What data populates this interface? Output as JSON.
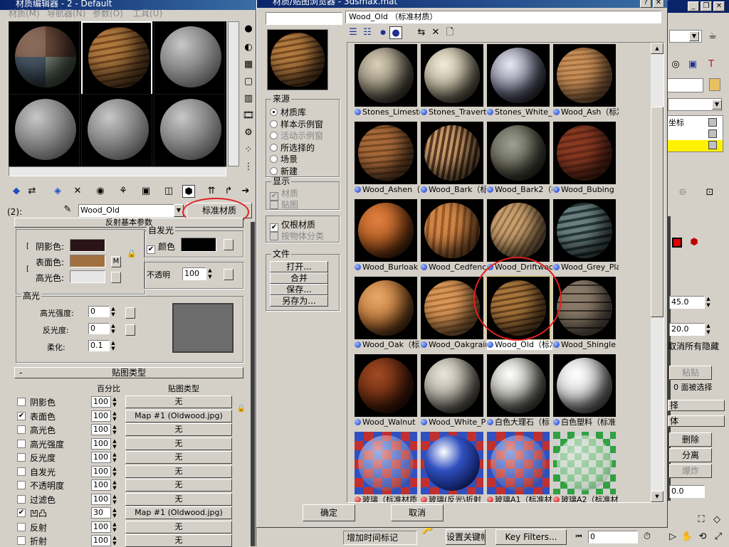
{
  "left_window": {
    "title": "材质编辑器 - 2 - Default",
    "menu": [
      "材质(M)",
      "导航器(N)",
      "参数(O)",
      "工具(U)"
    ],
    "slot_label": "(2):",
    "material_name": "Wood_Old",
    "material_type_button": "标准材质",
    "rollout_title": "反射基本参数",
    "ambient_label": "阴影色:",
    "diffuse_label": "表面色:",
    "specular_label": "高光色:",
    "m_button": "M",
    "self_illum_title": "自发光",
    "color_label": "颜色",
    "opacity_label": "不透明",
    "opacity_value": "100",
    "specular_group": "高光",
    "spec_level_label": "高光强度:",
    "spec_level_value": "0",
    "glossiness_label": "反光度:",
    "glossiness_value": "0",
    "soften_label": "柔化:",
    "soften_value": "0.1",
    "maps_rollout_title": "贴图类型",
    "maps_minus": "-",
    "maps_col_amount": "百分比",
    "maps_col_type": "贴图类型",
    "maps": [
      {
        "name": "阴影色",
        "checked": false,
        "amount": "100",
        "map": "无"
      },
      {
        "name": "表面色",
        "checked": true,
        "amount": "100",
        "map": "Map #1 (Oldwood.jpg)"
      },
      {
        "name": "高光色",
        "checked": false,
        "amount": "100",
        "map": "无"
      },
      {
        "name": "高光强度",
        "checked": false,
        "amount": "100",
        "map": "无"
      },
      {
        "name": "反光度",
        "checked": false,
        "amount": "100",
        "map": "无"
      },
      {
        "name": "自发光",
        "checked": false,
        "amount": "100",
        "map": "无"
      },
      {
        "name": "不透明度",
        "checked": false,
        "amount": "100",
        "map": "无"
      },
      {
        "name": "过滤色",
        "checked": false,
        "amount": "100",
        "map": "无"
      },
      {
        "name": "凹凸",
        "checked": true,
        "amount": "30",
        "map": "Map #1 (Oldwood.jpg)"
      },
      {
        "name": "反射",
        "checked": false,
        "amount": "100",
        "map": "无"
      },
      {
        "name": "折射",
        "checked": false,
        "amount": "100",
        "map": "无"
      }
    ]
  },
  "browser": {
    "title": "材质/贴图浏览器 - 3dsmax.mat",
    "selected_display": "Wood_Old （标准材质）",
    "source_group": "来源",
    "source_options": [
      "材质库",
      "样本示例窗",
      "活动示例窗",
      "所选择的",
      "场景",
      "新建"
    ],
    "display_group": "显示",
    "display_options": [
      "材质",
      "贴图"
    ],
    "root_only": "仅根材质",
    "by_object": "按物体分类",
    "file_group": "文件",
    "file_buttons": [
      "打开...",
      "合并",
      "保存...",
      "另存为..."
    ],
    "ok": "确定",
    "cancel": "取消",
    "items": [
      {
        "label": "Stones_Limesto",
        "style": "limestone"
      },
      {
        "label": "Stones_Travertin",
        "style": "travertine"
      },
      {
        "label": "Stones_White_C",
        "style": "whitestone"
      },
      {
        "label": "Wood_Ash（标准",
        "style": "ash"
      },
      {
        "label": "Wood_Ashen（标",
        "style": "ashen"
      },
      {
        "label": "Wood_Bark（标准",
        "style": "bark"
      },
      {
        "label": "Wood_Bark2（标",
        "style": "bark2"
      },
      {
        "label": "Wood_Bubing（",
        "style": "bubing"
      },
      {
        "label": "Wood_Burloak（",
        "style": "burloak"
      },
      {
        "label": "Wood_Cedfence",
        "style": "cedfence"
      },
      {
        "label": "Wood_Driftwood",
        "style": "driftwood"
      },
      {
        "label": "Wood_Grey_Pla",
        "style": "greyplank"
      },
      {
        "label": "Wood_Oak（标准",
        "style": "oak"
      },
      {
        "label": "Wood_Oakgrain",
        "style": "oakgrain"
      },
      {
        "label": "Wood_Old（标准",
        "style": "old"
      },
      {
        "label": "Wood_Shingle（",
        "style": "shingle"
      },
      {
        "label": "Wood_Walnut（",
        "style": "walnut"
      },
      {
        "label": "Wood_White_Pl",
        "style": "whitepl"
      },
      {
        "label": "白色大理石（标",
        "style": "marble"
      },
      {
        "label": "白色塑料（标准",
        "style": "plastic"
      },
      {
        "label": "玻璃（标准材质",
        "style": "glass1",
        "dot": "red"
      },
      {
        "label": "玻璃(反光\\折射",
        "style": "glass2",
        "dot": "red"
      },
      {
        "label": "玻璃A1（标准材",
        "style": "glass3",
        "dot": "red"
      },
      {
        "label": "玻璃A2（标准材",
        "style": "glass4",
        "dot": "red"
      }
    ]
  },
  "right_panel": {
    "label_coords": "坐标",
    "spin_value_1": "45.0",
    "spin_value_2": "20.0",
    "cancel_hidden": "取消所有隐藏",
    "paste": "粘贴",
    "zero_selected": "0 面被选择",
    "select_label": "择",
    "solid_label": "体",
    "delete_btn": "删除",
    "detach_btn": "分离",
    "explode_btn": "爆炸",
    "bottom_value": "0.0"
  },
  "status_bar": {
    "add_time_tag": "增加时间标记",
    "set_key": "设置关键帧",
    "key_filters": "Key Filters...",
    "frame": "0"
  }
}
